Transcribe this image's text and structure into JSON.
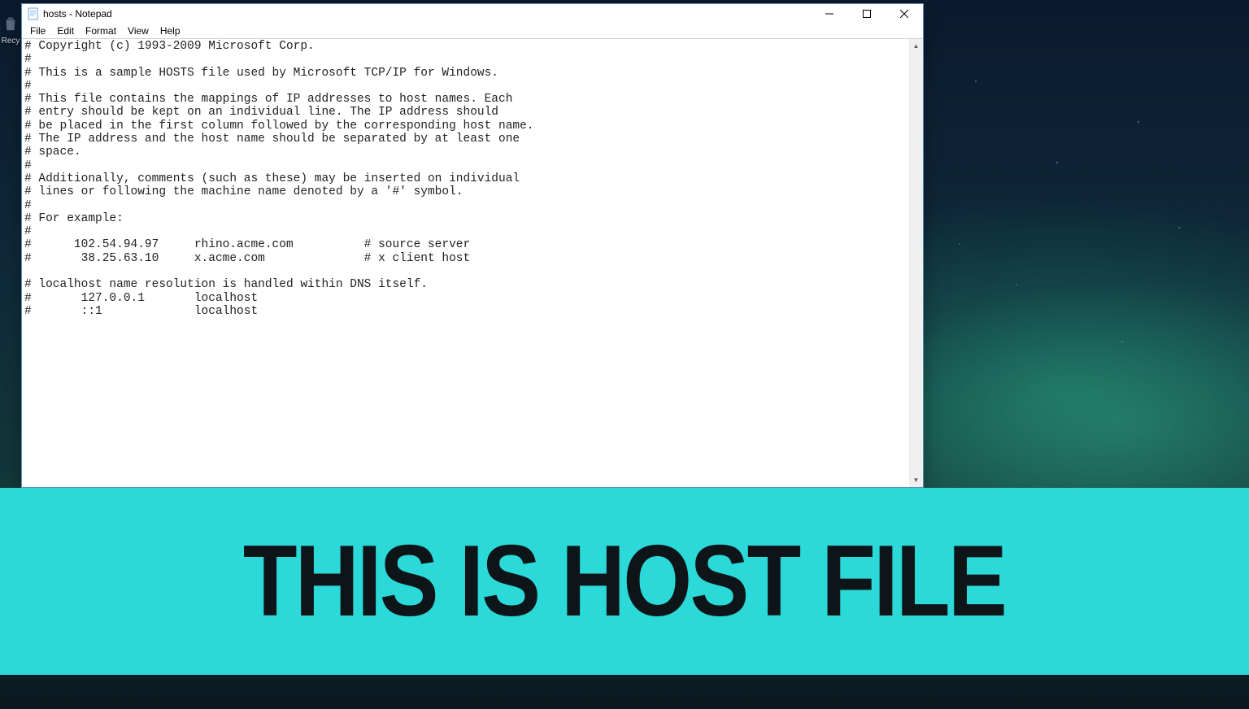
{
  "desktop": {
    "recycle_label": "Recy"
  },
  "window": {
    "title": "hosts - Notepad"
  },
  "menubar": {
    "items": [
      "File",
      "Edit",
      "Format",
      "View",
      "Help"
    ]
  },
  "textarea": {
    "content": "# Copyright (c) 1993-2009 Microsoft Corp.\n#\n# This is a sample HOSTS file used by Microsoft TCP/IP for Windows.\n#\n# This file contains the mappings of IP addresses to host names. Each\n# entry should be kept on an individual line. The IP address should\n# be placed in the first column followed by the corresponding host name.\n# The IP address and the host name should be separated by at least one\n# space.\n#\n# Additionally, comments (such as these) may be inserted on individual\n# lines or following the machine name denoted by a '#' symbol.\n#\n# For example:\n#\n#      102.54.94.97     rhino.acme.com          # source server\n#       38.25.63.10     x.acme.com              # x client host\n\n# localhost name resolution is handled within DNS itself.\n#       127.0.0.1       localhost\n#       ::1             localhost"
  },
  "banner": {
    "text": "THIS IS HOST FILE"
  }
}
